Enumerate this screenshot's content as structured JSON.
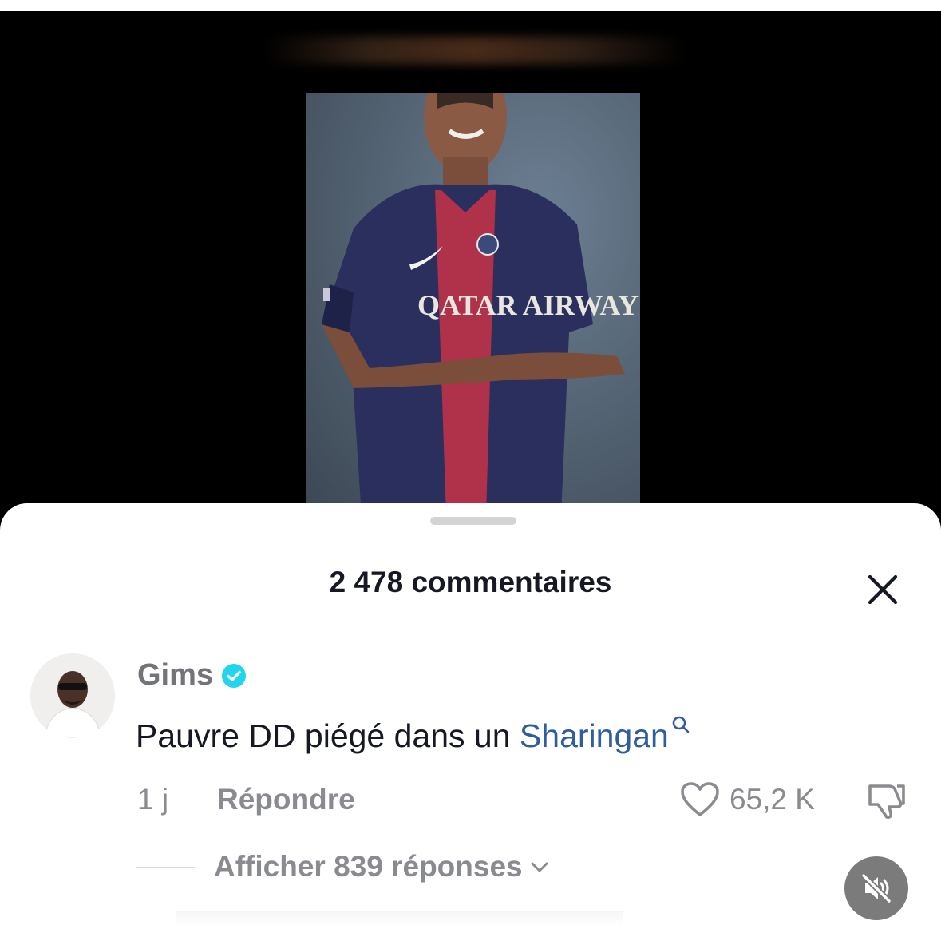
{
  "comments": {
    "title": "2 478 commentaires",
    "close_icon": "close-icon"
  },
  "comment": {
    "username": "Gims",
    "verified_color": "#20d5ec",
    "text_prefix": "Pauvre DD piégé dans un ",
    "highlighted_word": "Sharingan",
    "link_color": "#2f5da0",
    "time": "1 j",
    "reply_label": "Répondre",
    "like_count": "65,2 K",
    "show_replies": "Afficher 839 réponses"
  },
  "video": {
    "sponsor_text": "QATAR AIRWAYS",
    "jersey_colors": [
      "#2a2f5e",
      "#b0314a"
    ]
  },
  "controls": {
    "mute_icon": "speaker-muted-icon"
  }
}
